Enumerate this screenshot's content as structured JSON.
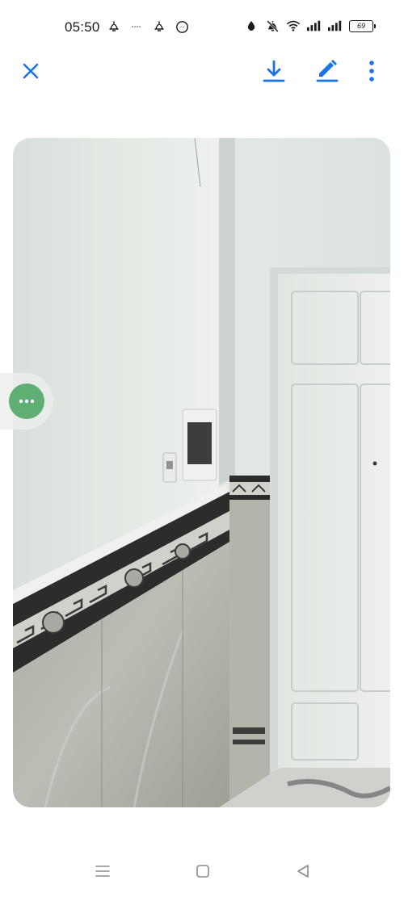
{
  "status_bar": {
    "time": "05:50",
    "battery_level": "69",
    "left_icons": [
      "notification-bell-icon",
      "dash-icon",
      "notification-bell-icon",
      "messenger-icon"
    ],
    "right_icons": [
      "data-saver-icon",
      "mute-icon",
      "wifi-icon",
      "signal-icon",
      "signal-icon",
      "battery-icon"
    ]
  },
  "toolbar": {
    "actions": [
      "close-icon",
      "download-icon",
      "edit-icon",
      "more-vert-icon"
    ]
  },
  "colors": {
    "accent": "#1a73e8",
    "bubble": "#5fae74",
    "nav_icons": "#8a8a8a"
  },
  "navigation_bar": {
    "buttons": [
      "menu-icon",
      "home-square-icon",
      "back-triangle-icon"
    ]
  }
}
